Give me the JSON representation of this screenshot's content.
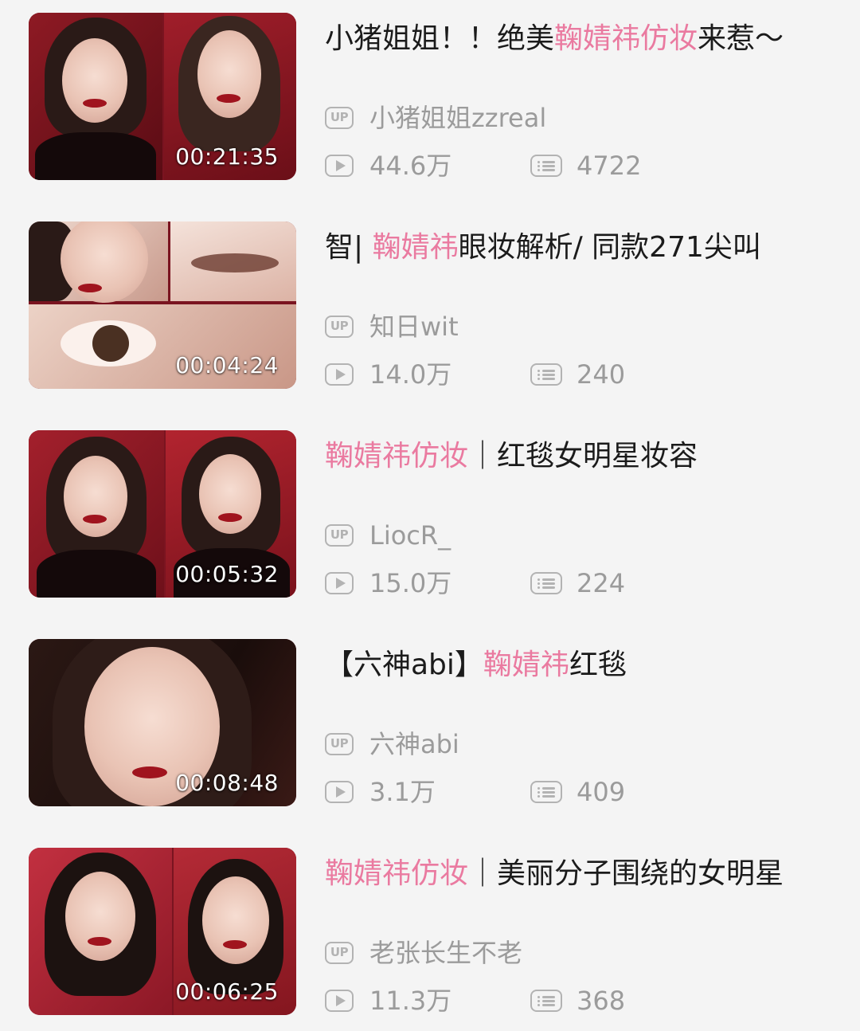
{
  "videos": [
    {
      "title_parts": [
        {
          "text": "小猪姐姐！！绝美",
          "highlight": false
        },
        {
          "text": "鞠婧祎仿妆",
          "highlight": true
        },
        {
          "text": "来惹～",
          "highlight": false
        }
      ],
      "duration": "00:21:35",
      "uploader": "小猪姐姐zzreal",
      "views": "44.6万",
      "danmaku": "4722"
    },
    {
      "title_parts": [
        {
          "text": "智| ",
          "highlight": false
        },
        {
          "text": "鞠婧祎",
          "highlight": true
        },
        {
          "text": "眼妆解析/ 同款271尖叫",
          "highlight": false
        }
      ],
      "duration": "00:04:24",
      "uploader": "知日wit",
      "views": "14.0万",
      "danmaku": "240"
    },
    {
      "title_parts": [
        {
          "text": "鞠婧祎仿妆",
          "highlight": true
        },
        {
          "text": "｜红毯女明星妆容",
          "highlight": false
        }
      ],
      "duration": "00:05:32",
      "uploader": "LiocR_",
      "views": "15.0万",
      "danmaku": "224"
    },
    {
      "title_parts": [
        {
          "text": "【六神abi】",
          "highlight": false
        },
        {
          "text": "鞠婧祎",
          "highlight": true
        },
        {
          "text": "红毯",
          "highlight": false
        }
      ],
      "duration": "00:08:48",
      "uploader": "六神abi",
      "views": "3.1万",
      "danmaku": "409"
    },
    {
      "title_parts": [
        {
          "text": "鞠婧祎仿妆",
          "highlight": true
        },
        {
          "text": "｜美丽分子围绕的女明星",
          "highlight": false
        }
      ],
      "duration": "00:06:25",
      "uploader": "老张长生不老",
      "views": "11.3万",
      "danmaku": "368"
    }
  ],
  "icons": {
    "up_badge": "UP",
    "play": "play-icon",
    "danmaku": "danmaku-icon"
  },
  "colors": {
    "highlight": "#ea7aa0",
    "meta": "#9b9b9b",
    "background": "#f4f4f4"
  }
}
